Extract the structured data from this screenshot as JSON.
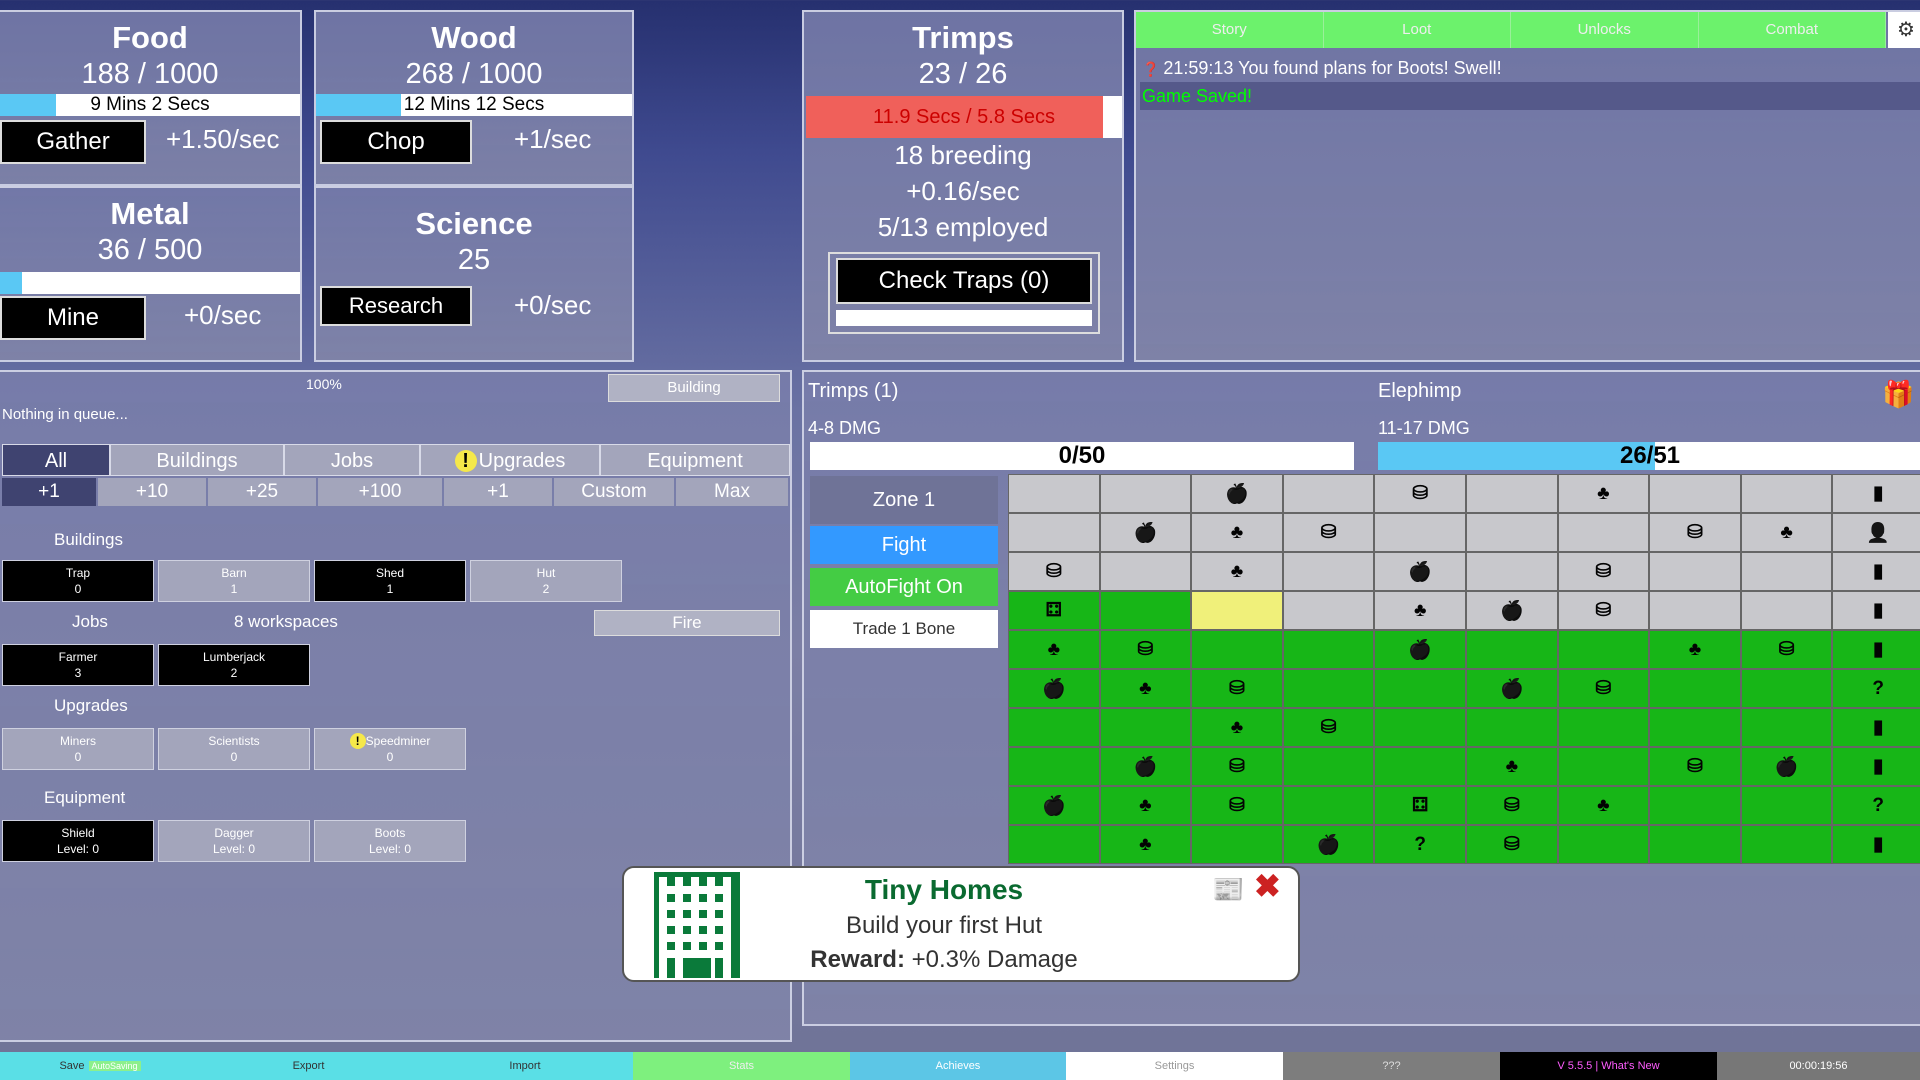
{
  "food": {
    "title": "Food",
    "amount": "188 / 1000",
    "timer": "9 Mins 2 Secs",
    "fill": 0.188,
    "button": "Gather",
    "rate": "+1.50/sec"
  },
  "wood": {
    "title": "Wood",
    "amount": "268 / 1000",
    "timer": "12 Mins 12 Secs",
    "fill": 0.268,
    "button": "Chop",
    "rate": "+1/sec"
  },
  "metal": {
    "title": "Metal",
    "amount": "36 / 500",
    "fill": 0.072,
    "button": "Mine",
    "rate": "+0/sec"
  },
  "science": {
    "title": "Science",
    "amount": "25",
    "button": "Research",
    "rate": "+0/sec"
  },
  "trimps": {
    "title": "Trimps",
    "amount": "23 / 26",
    "breed_timer": "11.9 Secs / 5.8 Secs",
    "breed_fill": 0.94,
    "breeding": "18 breeding",
    "rate": "+0.16/sec",
    "employed": "5/13 employed",
    "traps_button": "Check Traps (0)"
  },
  "log": {
    "tabs": [
      "Story",
      "Loot",
      "Unlocks",
      "Combat"
    ],
    "settings_icon": "gear-icon",
    "messages": [
      {
        "icon": "question-icon",
        "time": "21:59:13",
        "text": "You found plans for Boots! Swell!",
        "color": "#ffffff"
      },
      {
        "icon": "",
        "time": "",
        "text": "Game Saved!",
        "color": "#00ff00"
      }
    ]
  },
  "queue": {
    "percent": "100%",
    "building_label": "Building",
    "empty_text": "Nothing in queue..."
  },
  "buy_tabs": [
    "All",
    "Buildings",
    "Jobs",
    "Upgrades",
    "Equipment"
  ],
  "amount_row": [
    "+1",
    "+10",
    "+25",
    "+100",
    "+1",
    "Custom",
    "Max"
  ],
  "buildings": {
    "title": "Buildings",
    "items": [
      {
        "name": "Trap",
        "count": "0",
        "style": "black"
      },
      {
        "name": "Barn",
        "count": "1",
        "style": "grey"
      },
      {
        "name": "Shed",
        "count": "1",
        "style": "black"
      },
      {
        "name": "Hut",
        "count": "2",
        "style": "grey"
      }
    ]
  },
  "jobs": {
    "title": "Jobs",
    "workspaces": "8 workspaces",
    "fire_label": "Fire",
    "items": [
      {
        "name": "Farmer",
        "count": "3",
        "style": "black"
      },
      {
        "name": "Lumberjack",
        "count": "2",
        "style": "black"
      }
    ]
  },
  "upgrades": {
    "title": "Upgrades",
    "items": [
      {
        "name": "Miners",
        "count": "0",
        "style": "grey"
      },
      {
        "name": "Scientists",
        "count": "0",
        "style": "grey"
      },
      {
        "name": "Speedminer",
        "count": "0",
        "style": "grey",
        "alert": true
      }
    ]
  },
  "equipment": {
    "title": "Equipment",
    "items": [
      {
        "name": "Shield",
        "level": "Level: 0",
        "style": "black"
      },
      {
        "name": "Dagger",
        "level": "Level: 0",
        "style": "grey"
      },
      {
        "name": "Boots",
        "level": "Level: 0",
        "style": "grey"
      }
    ]
  },
  "battle": {
    "trimps_label": "Trimps (1)",
    "trimps_dmg": "4-8 DMG",
    "trimps_health": "0/50",
    "trimps_health_fill": 0,
    "enemy_label": "Elephimp",
    "enemy_dmg": "11-17 DMG",
    "enemy_health": "26/51",
    "enemy_health_fill": 0.51,
    "zone": "Zone 1",
    "fight": "Fight",
    "autofight": "AutoFight On",
    "trade": "Trade 1 Bone"
  },
  "map": {
    "colors": {
      "cleared": "#17b617",
      "current": "#f0f07a",
      "empty": "#c8c8cc"
    },
    "rows": [
      [
        "",
        "",
        "apple",
        "",
        "stack",
        "",
        "tree",
        "",
        "",
        "book"
      ],
      [
        "",
        "apple",
        "tree",
        "stack",
        "",
        "",
        "",
        "stack",
        "tree",
        "person"
      ],
      [
        "stack",
        "",
        "tree",
        "",
        "apple",
        "",
        "stack",
        "",
        "",
        "book"
      ],
      [
        "gift",
        "",
        "",
        "",
        "tree",
        "apple",
        "stack",
        "",
        "",
        "book"
      ],
      [
        "tree",
        "stack",
        "",
        "",
        "apple",
        "",
        "",
        "tree",
        "stack",
        "book"
      ],
      [
        "apple",
        "tree",
        "stack",
        "",
        "",
        "apple",
        "stack",
        "",
        "",
        "question"
      ],
      [
        "",
        "",
        "tree",
        "stack",
        "",
        "",
        "",
        "",
        "",
        "book"
      ],
      [
        "",
        "apple",
        "stack",
        "",
        "",
        "tree",
        "",
        "stack",
        "apple",
        "book"
      ],
      [
        "apple",
        "tree",
        "stack",
        "",
        "gift",
        "stack",
        "tree",
        "",
        "",
        "question"
      ],
      [
        "",
        "tree",
        "",
        "apple",
        "question",
        "stack",
        "",
        "",
        "",
        "book"
      ]
    ],
    "status": [
      [
        "e",
        "e",
        "e",
        "e",
        "e",
        "e",
        "e",
        "e",
        "e",
        "e"
      ],
      [
        "e",
        "e",
        "e",
        "e",
        "e",
        "e",
        "e",
        "e",
        "e",
        "e"
      ],
      [
        "e",
        "e",
        "e",
        "e",
        "e",
        "e",
        "e",
        "e",
        "e",
        "e"
      ],
      [
        "c",
        "c",
        "y",
        "e",
        "e",
        "e",
        "e",
        "e",
        "e",
        "e"
      ],
      [
        "c",
        "c",
        "c",
        "c",
        "c",
        "c",
        "c",
        "c",
        "c",
        "c"
      ],
      [
        "c",
        "c",
        "c",
        "c",
        "c",
        "c",
        "c",
        "c",
        "c",
        "c"
      ],
      [
        "c",
        "c",
        "c",
        "c",
        "c",
        "c",
        "c",
        "c",
        "c",
        "c"
      ],
      [
        "c",
        "c",
        "c",
        "c",
        "c",
        "c",
        "c",
        "c",
        "c",
        "c"
      ],
      [
        "c",
        "c",
        "c",
        "c",
        "c",
        "c",
        "c",
        "c",
        "c",
        "c"
      ],
      [
        "c",
        "c",
        "c",
        "c",
        "c",
        "c",
        "c",
        "c",
        "c",
        "c"
      ]
    ]
  },
  "achievement": {
    "title": "Tiny Homes",
    "description": "Build your first Hut",
    "reward_label": "Reward:",
    "reward_value": "+0.3% Damage"
  },
  "footer": [
    {
      "label": "Save",
      "badge": "AutoSaving",
      "bg": "#5adfe6",
      "fg": "#333"
    },
    {
      "label": "Export",
      "bg": "#5adfe6",
      "fg": "#333"
    },
    {
      "label": "Import",
      "bg": "#5adfe6",
      "fg": "#333"
    },
    {
      "label": "Stats",
      "bg": "#7ef07e",
      "fg": "#eee"
    },
    {
      "label": "Achieves",
      "bg": "#5cc6e6",
      "fg": "#fff"
    },
    {
      "label": "Settings",
      "bg": "#ffffff",
      "fg": "#999"
    },
    {
      "label": "???",
      "bg": "#7d7d7d",
      "fg": "#ddd"
    },
    {
      "label": "V 5.5.5 | What's New",
      "bg": "#000000",
      "fg": "#ff5cff"
    },
    {
      "label": "00:00:19:56",
      "bg": "#777777",
      "fg": "#fff"
    }
  ]
}
